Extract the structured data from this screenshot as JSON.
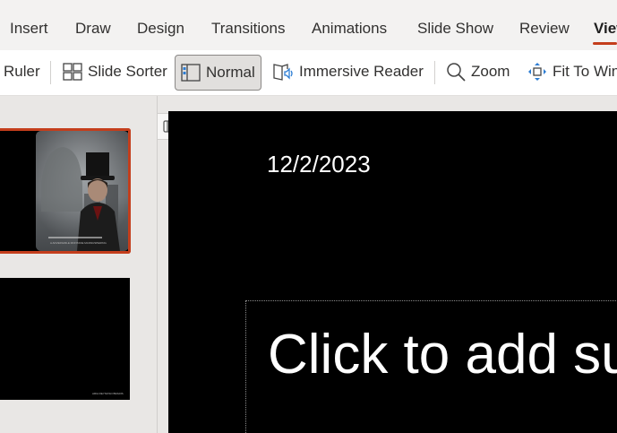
{
  "ribbon": {
    "tabs": [
      {
        "label": "Insert"
      },
      {
        "label": "Draw"
      },
      {
        "label": "Design"
      },
      {
        "label": "Transitions"
      },
      {
        "label": "Animations"
      },
      {
        "label": "Slide Show"
      },
      {
        "label": "Review"
      },
      {
        "label": "View"
      }
    ],
    "active_tab": "View",
    "accent_color": "#c43e1c"
  },
  "toolbar": {
    "ruler_label": "Ruler",
    "slide_sorter_label": "Slide Sorter",
    "normal_label": "Normal",
    "immersive_reader_label": "Immersive Reader",
    "zoom_label": "Zoom",
    "fit_to_window_label": "Fit To Window"
  },
  "thumbnails": {
    "slide1_caption": "A ADVERGIRLE MONTANE MANNUSPERING",
    "slide2_caption": "ARIA REYNOSO BRADIS"
  },
  "slide": {
    "date": "12/2/2023",
    "subtitle_placeholder": "Click to add subtitle"
  }
}
